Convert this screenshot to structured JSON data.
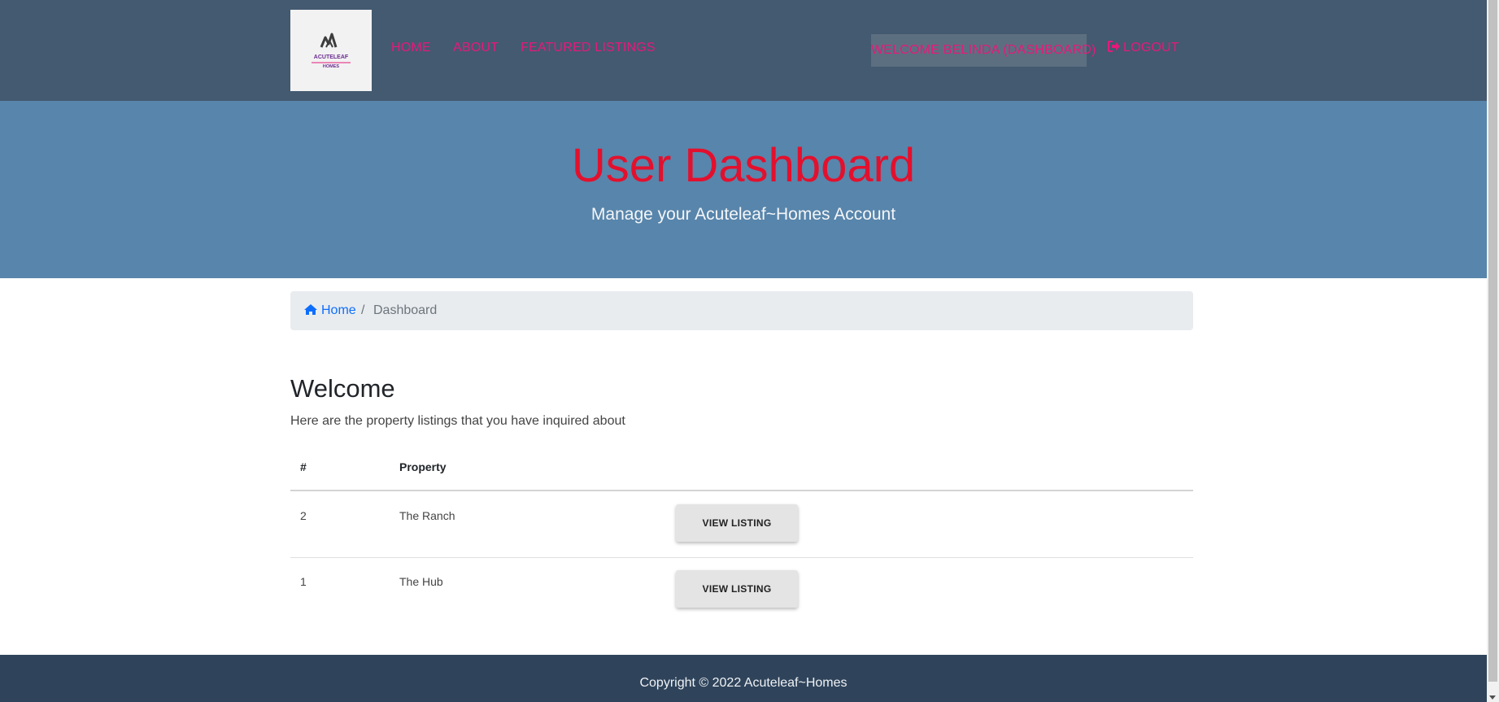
{
  "navbar": {
    "logo": {
      "line1": "ACUTELEAF",
      "line2": "HOMES"
    },
    "links": {
      "home": "HOME",
      "about": "ABOUT",
      "featured": "FEATURED LISTINGS"
    },
    "welcome": "WELCOME BELINDA (DASHBOARD)",
    "logout": "LOGOUT",
    "link_color": "#e6197a"
  },
  "hero": {
    "title": "User Dashboard",
    "subtitle": "Manage your Acuteleaf~Homes Account",
    "title_color": "#e3102d",
    "background": "#5885ab"
  },
  "breadcrumb": {
    "home": "Home",
    "separator": "/",
    "current": "Dashboard"
  },
  "main": {
    "heading": "Welcome",
    "subheading": "Here are the property listings that you have inquired about",
    "table": {
      "headers": [
        "#",
        "Property"
      ],
      "rows": [
        {
          "id": "2",
          "property": "The Ranch",
          "action": "VIEW LISTING"
        },
        {
          "id": "1",
          "property": "The Hub",
          "action": "VIEW LISTING"
        }
      ]
    }
  },
  "footer": {
    "copyright": "Copyright © 2022 Acuteleaf~Homes"
  },
  "icons": {
    "home": "home-icon",
    "logout": "sign-out-icon",
    "scroll_down": "chevron-down-icon"
  }
}
